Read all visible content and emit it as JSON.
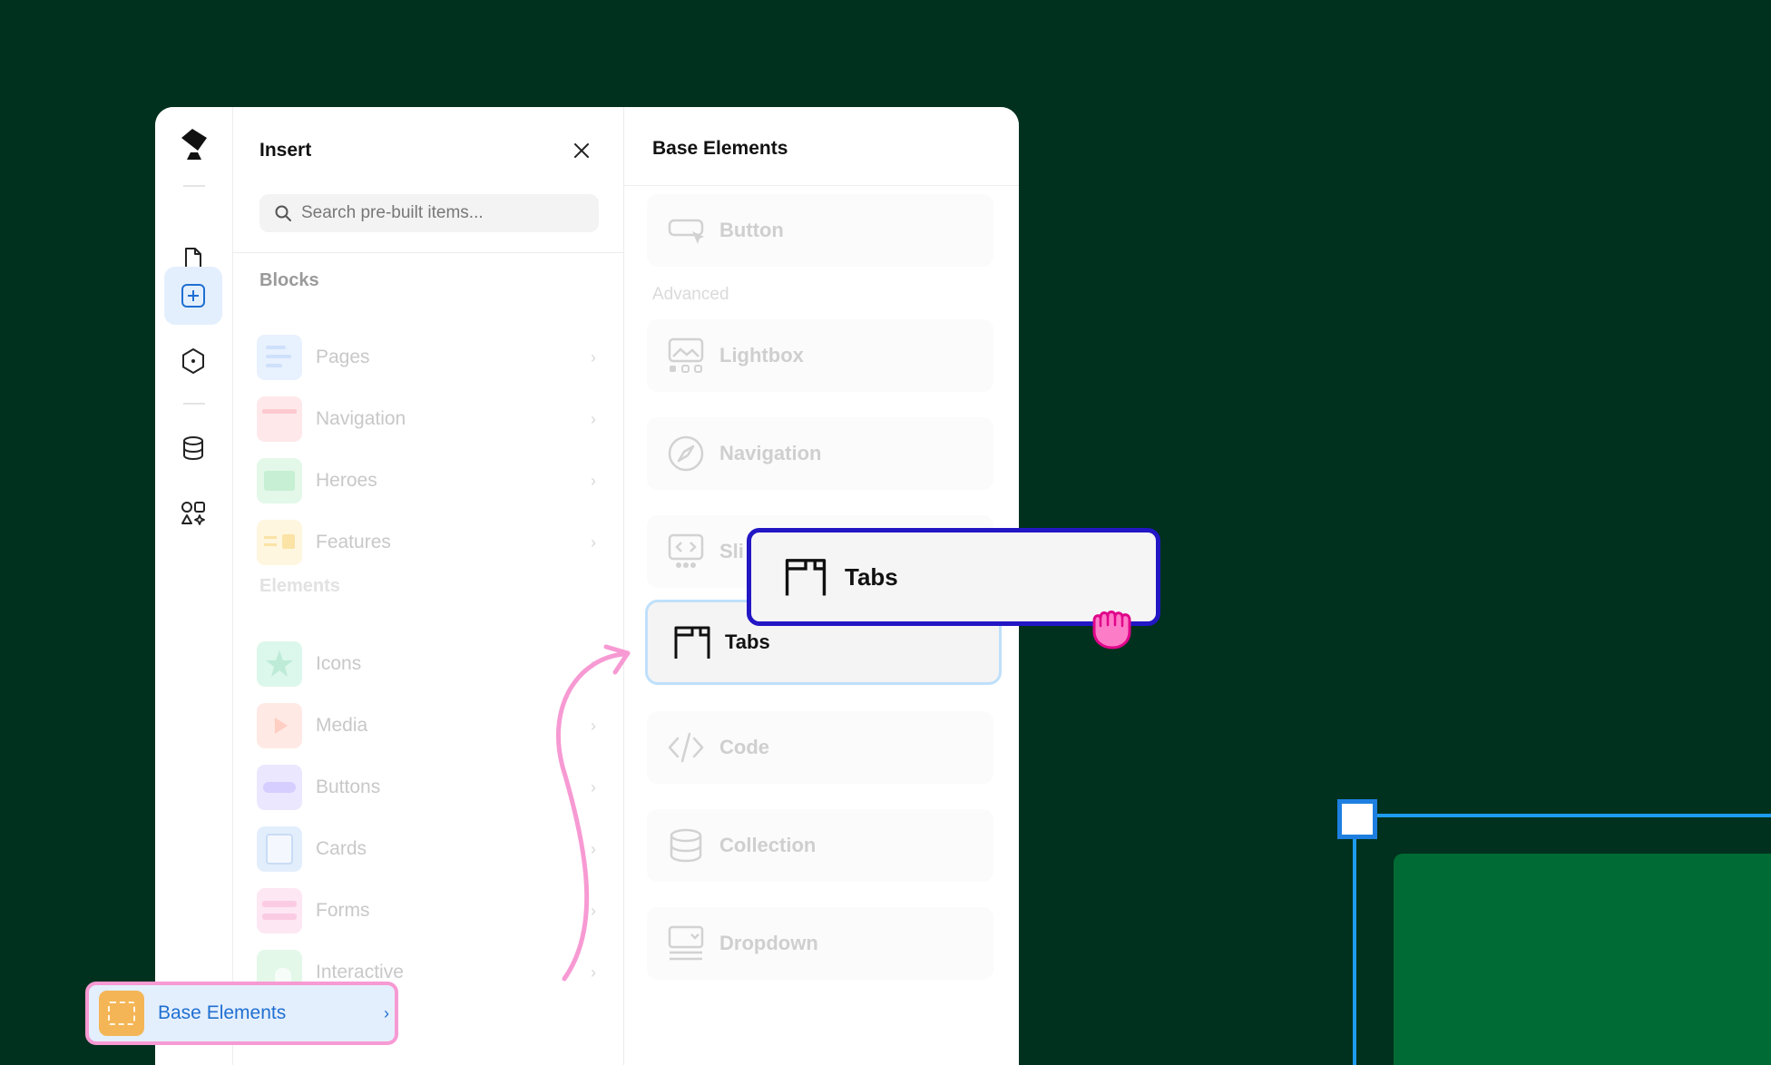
{
  "insert_panel": {
    "title": "Insert",
    "search": {
      "placeholder": "Search pre-built items..."
    },
    "blocks_label": "Blocks",
    "blocks": [
      {
        "label": "Pages",
        "color": "#dbeafe"
      },
      {
        "label": "Navigation",
        "color": "#fde2e4"
      },
      {
        "label": "Heroes",
        "color": "#dcfce7"
      },
      {
        "label": "Features",
        "color": "#fef3c7"
      }
    ],
    "elements_label": "Elements",
    "elements": [
      {
        "label": "Icons",
        "color": "#d1fae5"
      },
      {
        "label": "Media",
        "color": "#ffe4e0"
      },
      {
        "label": "Buttons",
        "color": "#e5e0ff"
      },
      {
        "label": "Cards",
        "color": "#dbeafe"
      },
      {
        "label": "Forms",
        "color": "#fce7f3"
      },
      {
        "label": "Interactive",
        "color": "#dcfce7"
      }
    ],
    "selected_item": {
      "label": "Base Elements",
      "chevron": "›"
    }
  },
  "base_panel": {
    "title": "Base Elements",
    "button_label": "Button",
    "advanced_label": "Advanced",
    "lightbox_label": "Lightbox",
    "navigation_label": "Navigation",
    "slider_label": "Sli",
    "tabs_label": "Tabs",
    "code_label": "Code",
    "collection_label": "Collection",
    "dropdown_label": "Dropdown"
  },
  "drag_ghost": {
    "label": "Tabs"
  },
  "colors": {
    "background": "#00311e",
    "accent_blue": "#1f6fd1",
    "drag_border": "#2216c5",
    "highlight_pink": "#f79ad3",
    "selection_blue": "#1e9bef",
    "canvas_green": "#006b35"
  }
}
